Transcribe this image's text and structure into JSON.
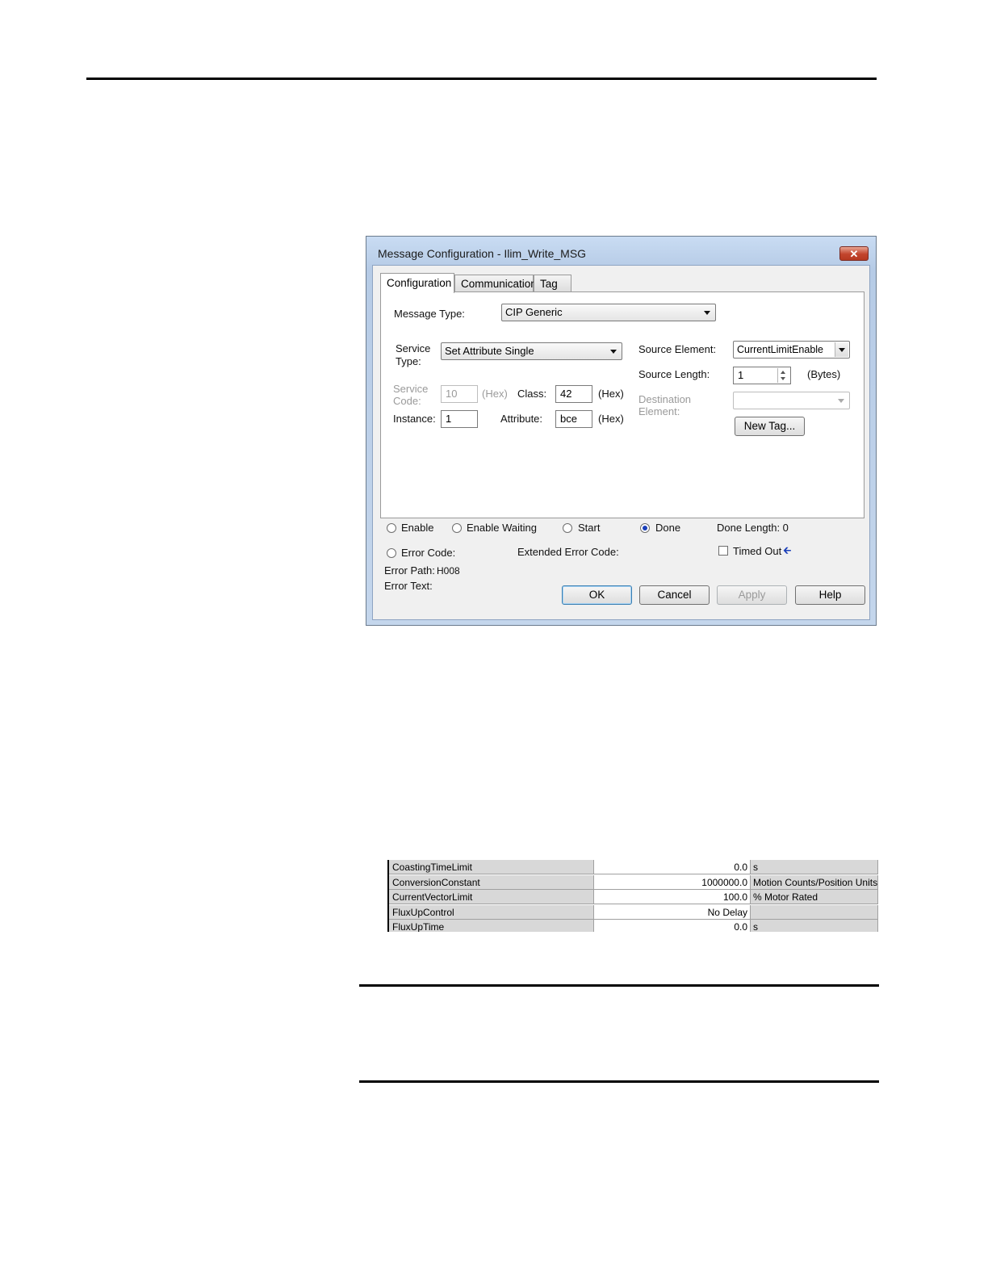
{
  "dialog": {
    "title": "Message Configuration - Ilim_Write_MSG",
    "close_label": "✕",
    "tabs": [
      "Configuration",
      "Communication",
      "Tag"
    ],
    "message_type": {
      "label": "Message Type:",
      "value": "CIP Generic"
    },
    "service_type": {
      "label_line1": "Service",
      "label_line2": "Type:",
      "value": "Set Attribute Single"
    },
    "service_code": {
      "label_line1": "Service",
      "label_line2": "Code:",
      "value": "10",
      "unit": "(Hex)"
    },
    "class": {
      "label": "Class:",
      "value": "42",
      "unit": "(Hex)"
    },
    "instance": {
      "label": "Instance:",
      "value": "1"
    },
    "attribute": {
      "label": "Attribute:",
      "value": "bce",
      "unit": "(Hex)"
    },
    "source_element": {
      "label": "Source Element:",
      "value": "CurrentLimitEnable"
    },
    "source_length": {
      "label": "Source Length:",
      "value": "1",
      "unit": "(Bytes)"
    },
    "destination_element": {
      "label_line1": "Destination",
      "label_line2": "Element:",
      "value": ""
    },
    "new_tag_label": "New Tag...",
    "status": {
      "enable": "Enable",
      "enable_waiting": "Enable Waiting",
      "start": "Start",
      "done": "Done",
      "done_length": "Done Length:  0",
      "error_code": "Error Code:",
      "extended_error_code": "Extended Error Code:",
      "timed_out": "Timed Out",
      "error_path_label": "Error Path:",
      "error_path_value": "H008",
      "error_text_label": "Error Text:"
    },
    "buttons": {
      "ok": "OK",
      "cancel": "Cancel",
      "apply": "Apply",
      "help": "Help"
    }
  },
  "parameters_table": {
    "rows": [
      {
        "name": "CoastingTimeLimit",
        "value": "0.0",
        "unit": "s"
      },
      {
        "name": "ConversionConstant",
        "value": "1000000.0",
        "unit": "Motion Counts/Position Units"
      },
      {
        "name": "CurrentVectorLimit",
        "value": "100.0",
        "unit": "% Motor Rated"
      },
      {
        "name": "FluxUpControl",
        "value": "No Delay",
        "unit": ""
      },
      {
        "name": "FluxUpTime",
        "value": "0.0",
        "unit": "s"
      }
    ]
  },
  "colors": {
    "done_radio": "#1a3fb8",
    "close_button": "#c2442c",
    "timed_out_arrow": "#1a3fb8"
  }
}
